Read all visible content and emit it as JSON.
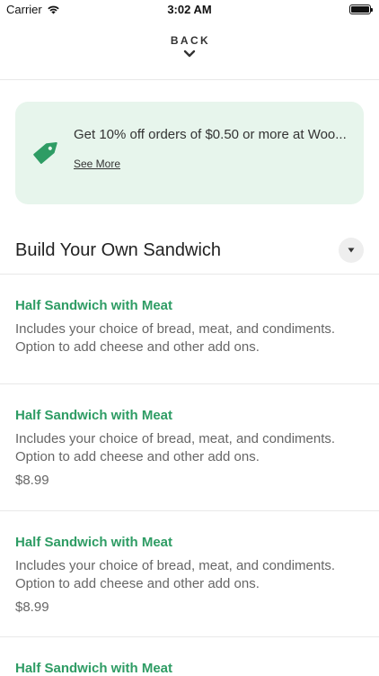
{
  "status_bar": {
    "carrier": "Carrier",
    "time": "3:02 AM",
    "wifi_icon": "wifi-icon",
    "battery_icon": "battery-icon"
  },
  "nav": {
    "back_label": "BACK",
    "chevron_icon": "chevron-down-icon"
  },
  "promo": {
    "icon": "tag-icon",
    "text": "Get 10% off orders of $0.50 or more at Woo...",
    "link": "See More"
  },
  "section": {
    "title": "Build Your Own Sandwich",
    "toggle_icon": "caret-down-icon"
  },
  "items": [
    {
      "name": "Half Sandwich with Meat",
      "description": "Includes your choice of bread, meat, and condiments. Option to add cheese and other add ons.",
      "price": ""
    },
    {
      "name": "Half Sandwich with Meat",
      "description": "Includes your choice of bread, meat, and condiments. Option to add cheese and other add ons.",
      "price": "$8.99"
    },
    {
      "name": "Half Sandwich with Meat",
      "description": "Includes your choice of bread, meat, and condiments. Option to add cheese and other add ons.",
      "price": "$8.99"
    },
    {
      "name": "Half Sandwich with Meat",
      "description": "",
      "price": ""
    }
  ],
  "colors": {
    "accent_green": "#2e9c64",
    "promo_bg": "#e7f5ec"
  }
}
